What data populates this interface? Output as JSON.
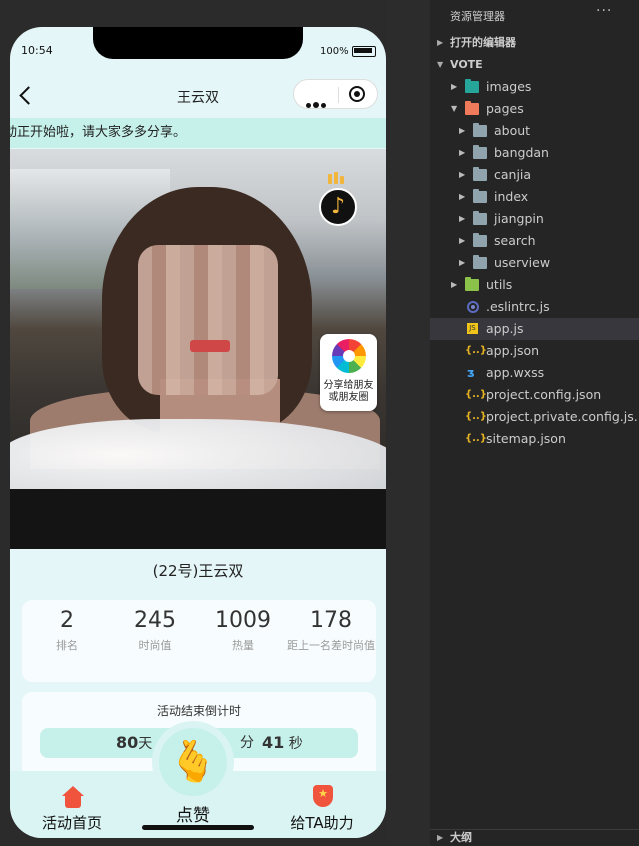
{
  "status_bar": {
    "time": "10:54",
    "battery": "100%"
  },
  "nav": {
    "title": "王云双"
  },
  "marquee": {
    "text": "动正开始啦，请大家多多分享。"
  },
  "share": {
    "label": "分享给朋友或朋友圈"
  },
  "contestant": {
    "name": "(22号)王云双"
  },
  "stats": [
    {
      "value": "2",
      "label": "排名"
    },
    {
      "value": "245",
      "label": "时尚值"
    },
    {
      "value": "1009",
      "label": "热量"
    },
    {
      "value": "178",
      "label": "距上一名差时尚值"
    }
  ],
  "countdown": {
    "title": "活动结束倒计时",
    "days_value": "80",
    "days_unit": "天",
    "mins_unit": "分",
    "secs_value": "41",
    "secs_unit": "秒"
  },
  "tabs": {
    "home": "活动首页",
    "like": "点赞",
    "help": "给TA助力"
  },
  "explorer": {
    "header": "资源管理器",
    "more": "···",
    "open_editors": "打开的编辑器",
    "project": "VOTE",
    "items": [
      {
        "label": "images",
        "type": "folder-images"
      },
      {
        "label": "pages",
        "type": "folder-pages"
      },
      {
        "label": "about",
        "type": "folder"
      },
      {
        "label": "bangdan",
        "type": "folder"
      },
      {
        "label": "canjia",
        "type": "folder"
      },
      {
        "label": "index",
        "type": "folder"
      },
      {
        "label": "jiangpin",
        "type": "folder"
      },
      {
        "label": "search",
        "type": "folder"
      },
      {
        "label": "userview",
        "type": "folder"
      },
      {
        "label": "utils",
        "type": "folder-utils"
      },
      {
        "label": ".eslintrc.js",
        "type": "eslint"
      },
      {
        "label": "app.js",
        "type": "js"
      },
      {
        "label": "app.json",
        "type": "json"
      },
      {
        "label": "app.wxss",
        "type": "wxss"
      },
      {
        "label": "project.config.json",
        "type": "json"
      },
      {
        "label": "project.private.config.js...",
        "type": "json"
      },
      {
        "label": "sitemap.json",
        "type": "json"
      }
    ],
    "outline": "大纲"
  }
}
